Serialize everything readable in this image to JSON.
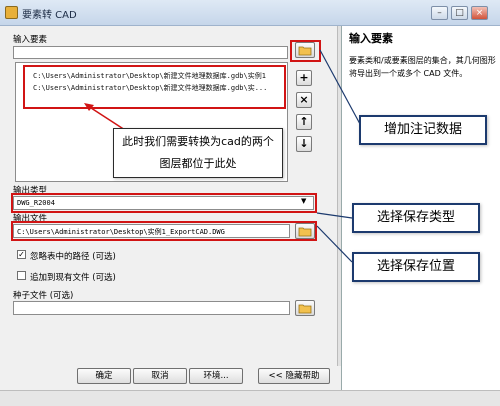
{
  "window": {
    "title": "要素转 CAD",
    "minimize": "–",
    "maximize": "□",
    "close": "×"
  },
  "input_features": {
    "label": "输入要素",
    "items": [
      "C:\\Users\\Administrator\\Desktop\\新建文件地理数据库.gdb\\实例1",
      "C:\\Users\\Administrator\\Desktop\\新建文件地理数据库.gdb\\实..."
    ]
  },
  "annotation_center": "此时我们需要转换为cad的两个图层都位于此处",
  "output_type": {
    "label": "输出类型",
    "value": "DWG_R2004"
  },
  "output_file": {
    "label": "输出文件",
    "value": "C:\\Users\\Administrator\\Desktop\\实例1_ExportCAD.DWG"
  },
  "options": {
    "ignore_paths": {
      "label": "忽略表中的路径  (可选)",
      "checked": true
    },
    "append": {
      "label": "追加到现有文件  (可选)",
      "checked": false
    }
  },
  "seed_file": {
    "label": "种子文件  (可选)",
    "value": ""
  },
  "buttons": {
    "ok": "确定",
    "cancel": "取消",
    "environments": "环境...",
    "hide_help": "<< 隐藏帮助"
  },
  "help": {
    "title": "输入要素",
    "text": "要素类和/或要素图层的集合，其几何图形将导出到一个或多个 CAD 文件。"
  },
  "callouts": {
    "add_annotation": "增加注记数据",
    "choose_type": "选择保存类型",
    "choose_location": "选择保存位置"
  },
  "colors": {
    "highlight_red": "#d11414",
    "callout_border": "#1c3a6e"
  }
}
